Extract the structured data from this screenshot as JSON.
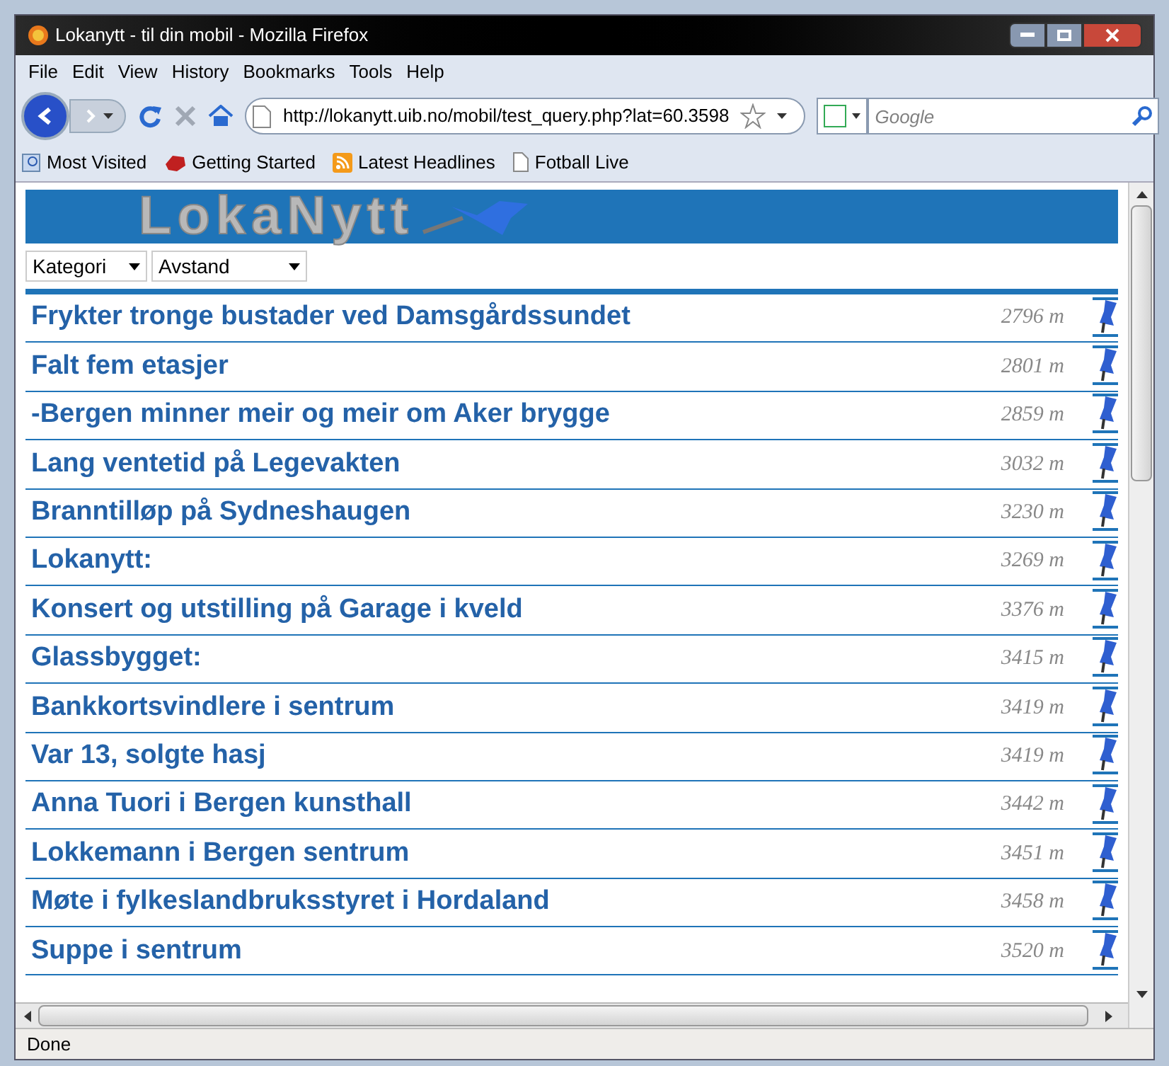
{
  "window": {
    "title": "Lokanytt - til din mobil - Mozilla Firefox"
  },
  "menu": [
    "File",
    "Edit",
    "View",
    "History",
    "Bookmarks",
    "Tools",
    "Help"
  ],
  "address": "http://lokanytt.uib.no/mobil/test_query.php?lat=60.3598",
  "search": {
    "placeholder": "Google"
  },
  "bookmarks": [
    {
      "label": "Most Visited",
      "kind": "search"
    },
    {
      "label": "Getting Started",
      "kind": "logo"
    },
    {
      "label": "Latest Headlines",
      "kind": "rss"
    },
    {
      "label": "Fotball Live",
      "kind": "page"
    }
  ],
  "banner": {
    "title": "LokaNytt"
  },
  "filters": [
    "Kategori",
    "Avstand"
  ],
  "news": [
    {
      "title": "Frykter tronge bustader ved Damsgårdssundet",
      "distance": "2796 m"
    },
    {
      "title": "Falt fem etasjer",
      "distance": "2801 m"
    },
    {
      "title": "-Bergen minner meir og meir om Aker brygge",
      "distance": "2859 m"
    },
    {
      "title": "Lang ventetid på Legevakten",
      "distance": "3032 m"
    },
    {
      "title": "Branntilløp på Sydneshaugen",
      "distance": "3230 m"
    },
    {
      "title": "Lokanytt:",
      "distance": "3269 m"
    },
    {
      "title": "Konsert og utstilling på Garage i kveld",
      "distance": "3376 m"
    },
    {
      "title": "Glassbygget:",
      "distance": "3415 m"
    },
    {
      "title": "Bankkortsvindlere i sentrum",
      "distance": "3419 m"
    },
    {
      "title": "Var 13, solgte hasj",
      "distance": "3419 m"
    },
    {
      "title": "Anna Tuori i Bergen kunsthall",
      "distance": "3442 m"
    },
    {
      "title": "Lokkemann i Bergen sentrum",
      "distance": "3451 m"
    },
    {
      "title": "Møte i fylkeslandbruksstyret i Hordaland",
      "distance": "3458 m"
    },
    {
      "title": "Suppe i sentrum",
      "distance": "3520 m"
    }
  ],
  "status_bar": "Done"
}
